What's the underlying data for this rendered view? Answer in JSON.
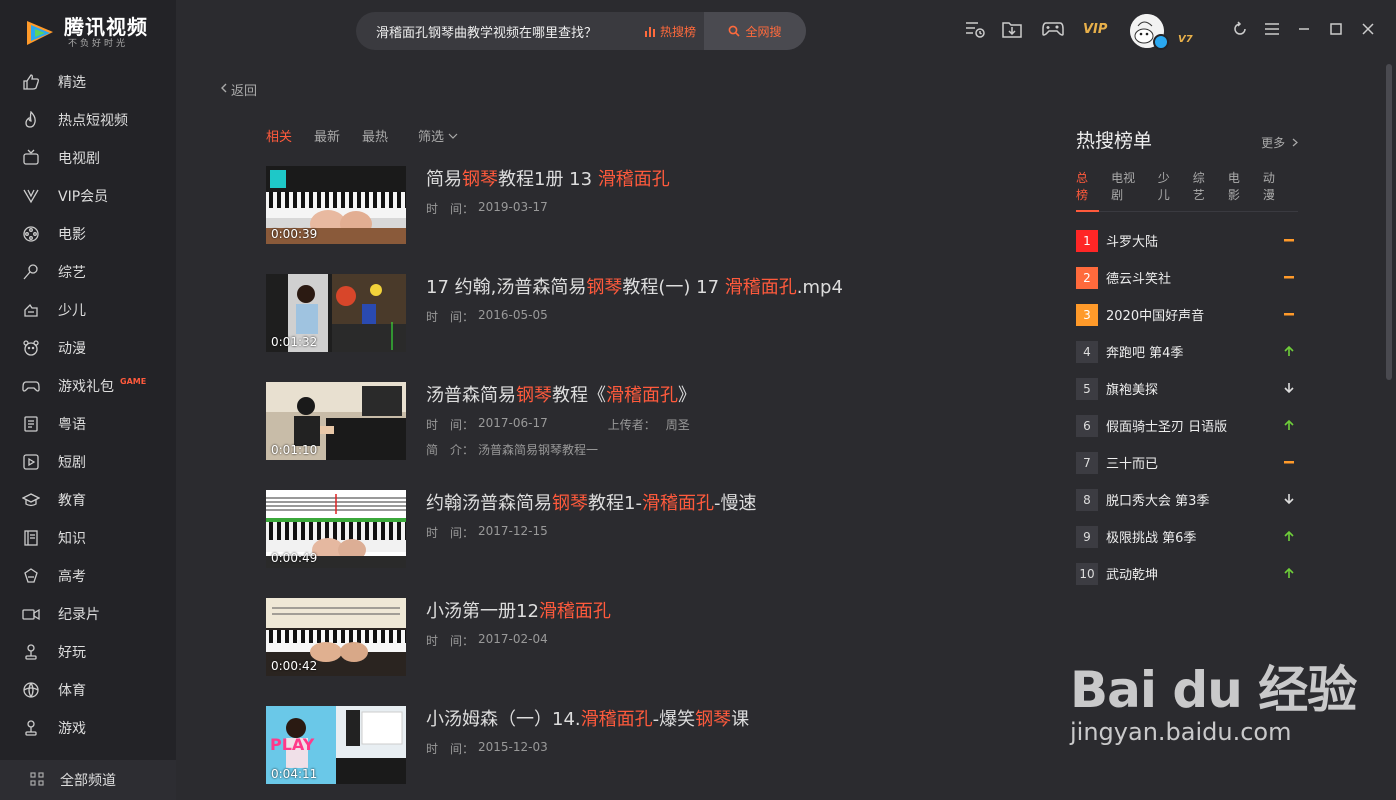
{
  "app": {
    "logo_title": "腾讯视频",
    "logo_slogan": "不负好时光"
  },
  "sidebar": {
    "items": [
      {
        "label": "精选",
        "icon": "thumbs-up-icon"
      },
      {
        "label": "热点短视频",
        "icon": "flame-icon"
      },
      {
        "label": "电视剧",
        "icon": "tv-icon"
      },
      {
        "label": "VIP会员",
        "icon": "vip-v-icon"
      },
      {
        "label": "电影",
        "icon": "film-reel-icon"
      },
      {
        "label": "综艺",
        "icon": "microphone-icon"
      },
      {
        "label": "少儿",
        "icon": "kids-icon"
      },
      {
        "label": "动漫",
        "icon": "bear-icon"
      },
      {
        "label": "游戏礼包",
        "icon": "gamepad-icon",
        "badge": "GAME"
      },
      {
        "label": "粤语",
        "icon": "book-icon"
      },
      {
        "label": "短剧",
        "icon": "play-square-icon"
      },
      {
        "label": "教育",
        "icon": "graduation-cap-icon"
      },
      {
        "label": "知识",
        "icon": "notebook-icon"
      },
      {
        "label": "高考",
        "icon": "pencil-icon"
      },
      {
        "label": "纪录片",
        "icon": "camera-icon"
      },
      {
        "label": "好玩",
        "icon": "joystick-icon"
      },
      {
        "label": "体育",
        "icon": "ball-icon"
      },
      {
        "label": "游戏",
        "icon": "joystick-icon"
      }
    ],
    "all_channels": "全部频道"
  },
  "search": {
    "value": "滑稽面孔钢琴曲教学视频在哪里查找？",
    "hot_label": "热搜榜",
    "button_label": "全网搜"
  },
  "header": {
    "vip": "VIP",
    "vip_level": "V7"
  },
  "main": {
    "back": "返回",
    "tabs": [
      "相关",
      "最新",
      "最热",
      "筛选"
    ],
    "results": [
      {
        "title_parts": [
          {
            "t": "简易",
            "h": false
          },
          {
            "t": "钢琴",
            "h": true
          },
          {
            "t": "教程1册 13 ",
            "h": false
          },
          {
            "t": "滑稽面孔",
            "h": true
          }
        ],
        "duration": "0:00:39",
        "time_label": "时　间：",
        "date": "2019-03-17"
      },
      {
        "title_parts": [
          {
            "t": "17 约翰,汤普森简易",
            "h": false
          },
          {
            "t": "钢琴",
            "h": true
          },
          {
            "t": "教程(一) 17 ",
            "h": false
          },
          {
            "t": "滑稽面孔",
            "h": true
          },
          {
            "t": ".mp4",
            "h": false
          }
        ],
        "duration": "0:01:32",
        "time_label": "时　间：",
        "date": "2016-05-05"
      },
      {
        "title_parts": [
          {
            "t": "汤普森简易",
            "h": false
          },
          {
            "t": "钢琴",
            "h": true
          },
          {
            "t": "教程《",
            "h": false
          },
          {
            "t": "滑稽面孔",
            "h": true
          },
          {
            "t": "》",
            "h": false
          }
        ],
        "duration": "0:01:10",
        "time_label": "时　间：",
        "date": "2017-06-17",
        "uploader_label": "上传者：",
        "uploader": "周圣",
        "intro_label": "简　介：",
        "intro": "汤普森简易钢琴教程一"
      },
      {
        "title_parts": [
          {
            "t": "约翰汤普森简易",
            "h": false
          },
          {
            "t": "钢琴",
            "h": true
          },
          {
            "t": "教程1-",
            "h": false
          },
          {
            "t": "滑稽面孔",
            "h": true
          },
          {
            "t": "-慢速",
            "h": false
          }
        ],
        "duration": "0:00:49",
        "time_label": "时　间：",
        "date": "2017-12-15"
      },
      {
        "title_parts": [
          {
            "t": "小汤第一册12",
            "h": false
          },
          {
            "t": "滑稽面孔",
            "h": true
          }
        ],
        "duration": "0:00:42",
        "time_label": "时　间：",
        "date": "2017-02-04"
      },
      {
        "title_parts": [
          {
            "t": "小汤姆森（一）14.",
            "h": false
          },
          {
            "t": "滑稽面孔",
            "h": true
          },
          {
            "t": "-爆笑",
            "h": false
          },
          {
            "t": "钢琴",
            "h": true
          },
          {
            "t": "课",
            "h": false
          }
        ],
        "duration": "0:04:11",
        "time_label": "时　间：",
        "date": "2015-12-03"
      }
    ]
  },
  "hot": {
    "title": "热搜榜单",
    "more": "更多",
    "tabs": [
      "总榜",
      "电视剧",
      "少儿",
      "综艺",
      "电影",
      "动漫"
    ],
    "items": [
      {
        "rank": "1",
        "name": "斗罗大陆",
        "trend": "flat"
      },
      {
        "rank": "2",
        "name": "德云斗笑社",
        "trend": "flat"
      },
      {
        "rank": "3",
        "name": "2020中国好声音",
        "trend": "flat"
      },
      {
        "rank": "4",
        "name": "奔跑吧 第4季",
        "trend": "up"
      },
      {
        "rank": "5",
        "name": "旗袍美探",
        "trend": "down"
      },
      {
        "rank": "6",
        "name": "假面骑士圣刃 日语版",
        "trend": "up"
      },
      {
        "rank": "7",
        "name": "三十而已",
        "trend": "flat"
      },
      {
        "rank": "8",
        "name": "脱口秀大会 第3季",
        "trend": "down"
      },
      {
        "rank": "9",
        "name": "极限挑战 第6季",
        "trend": "up"
      },
      {
        "rank": "10",
        "name": "武动乾坤",
        "trend": "up"
      }
    ]
  },
  "watermark": {
    "brand": "Bai du 经验",
    "url": "jingyan.baidu.com"
  },
  "colors": {
    "accent": "#ff5a3c",
    "background": "#2b2b2f",
    "sidebar": "#232327",
    "trend_up": "#6fcf3a",
    "trend_flat": "#ff9a2a"
  }
}
